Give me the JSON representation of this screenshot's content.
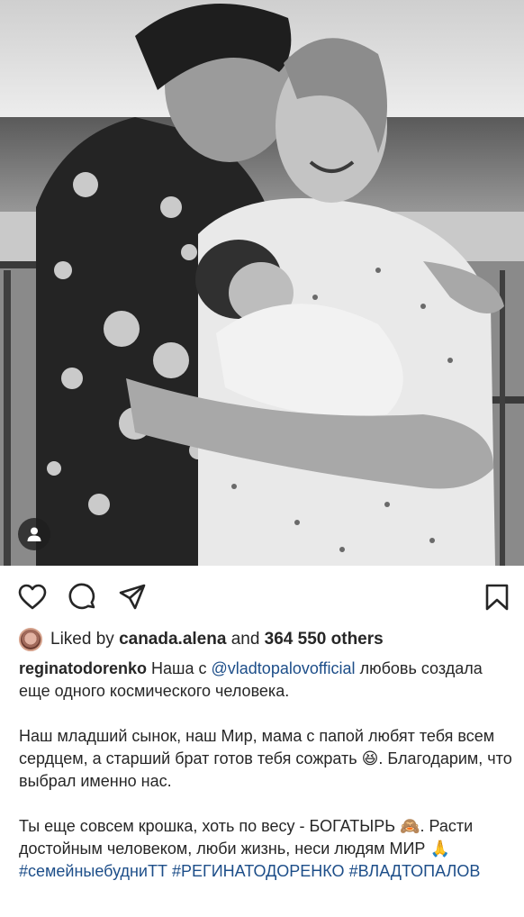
{
  "photo": {
    "alt_icon": "person-icon"
  },
  "actions": {
    "like_icon": "heart-icon",
    "comment_icon": "comment-icon",
    "share_icon": "send-icon",
    "save_icon": "bookmark-icon"
  },
  "likes": {
    "prefix": "Liked by",
    "user": "canada.alena",
    "connector": "and",
    "count_text": "364 550 others"
  },
  "caption": {
    "username": "reginatodorenko",
    "line1_a": "Наша с",
    "mention": "@vladtopalovofficial",
    "line1_b": "любовь создала еще одного космического человека.",
    "para2": "Наш младший сынок, наш Мир, мама с папой любят тебя всем сердцем, а старший брат готов тебя сожрать",
    "para2_emoji": "😆",
    "para2_end": ". Благодарим, что выбрал именно нас.",
    "para3_a": "Ты еще совсем крошка, хоть по весу - БОГАТЫРЬ",
    "para3_emoji1": "🙈",
    "para3_b": ". Расти достойным человеком, люби жизнь, неси людям МИР",
    "para3_emoji2": "🙏",
    "hashtag1": "#семейныебудниТТ",
    "hashtag2": "#РЕГИНАТОДОРЕНКО",
    "hashtag3": "#ВЛАДТОПАЛОВ"
  },
  "colors": {
    "link": "#1d4e89",
    "text": "#262626"
  }
}
